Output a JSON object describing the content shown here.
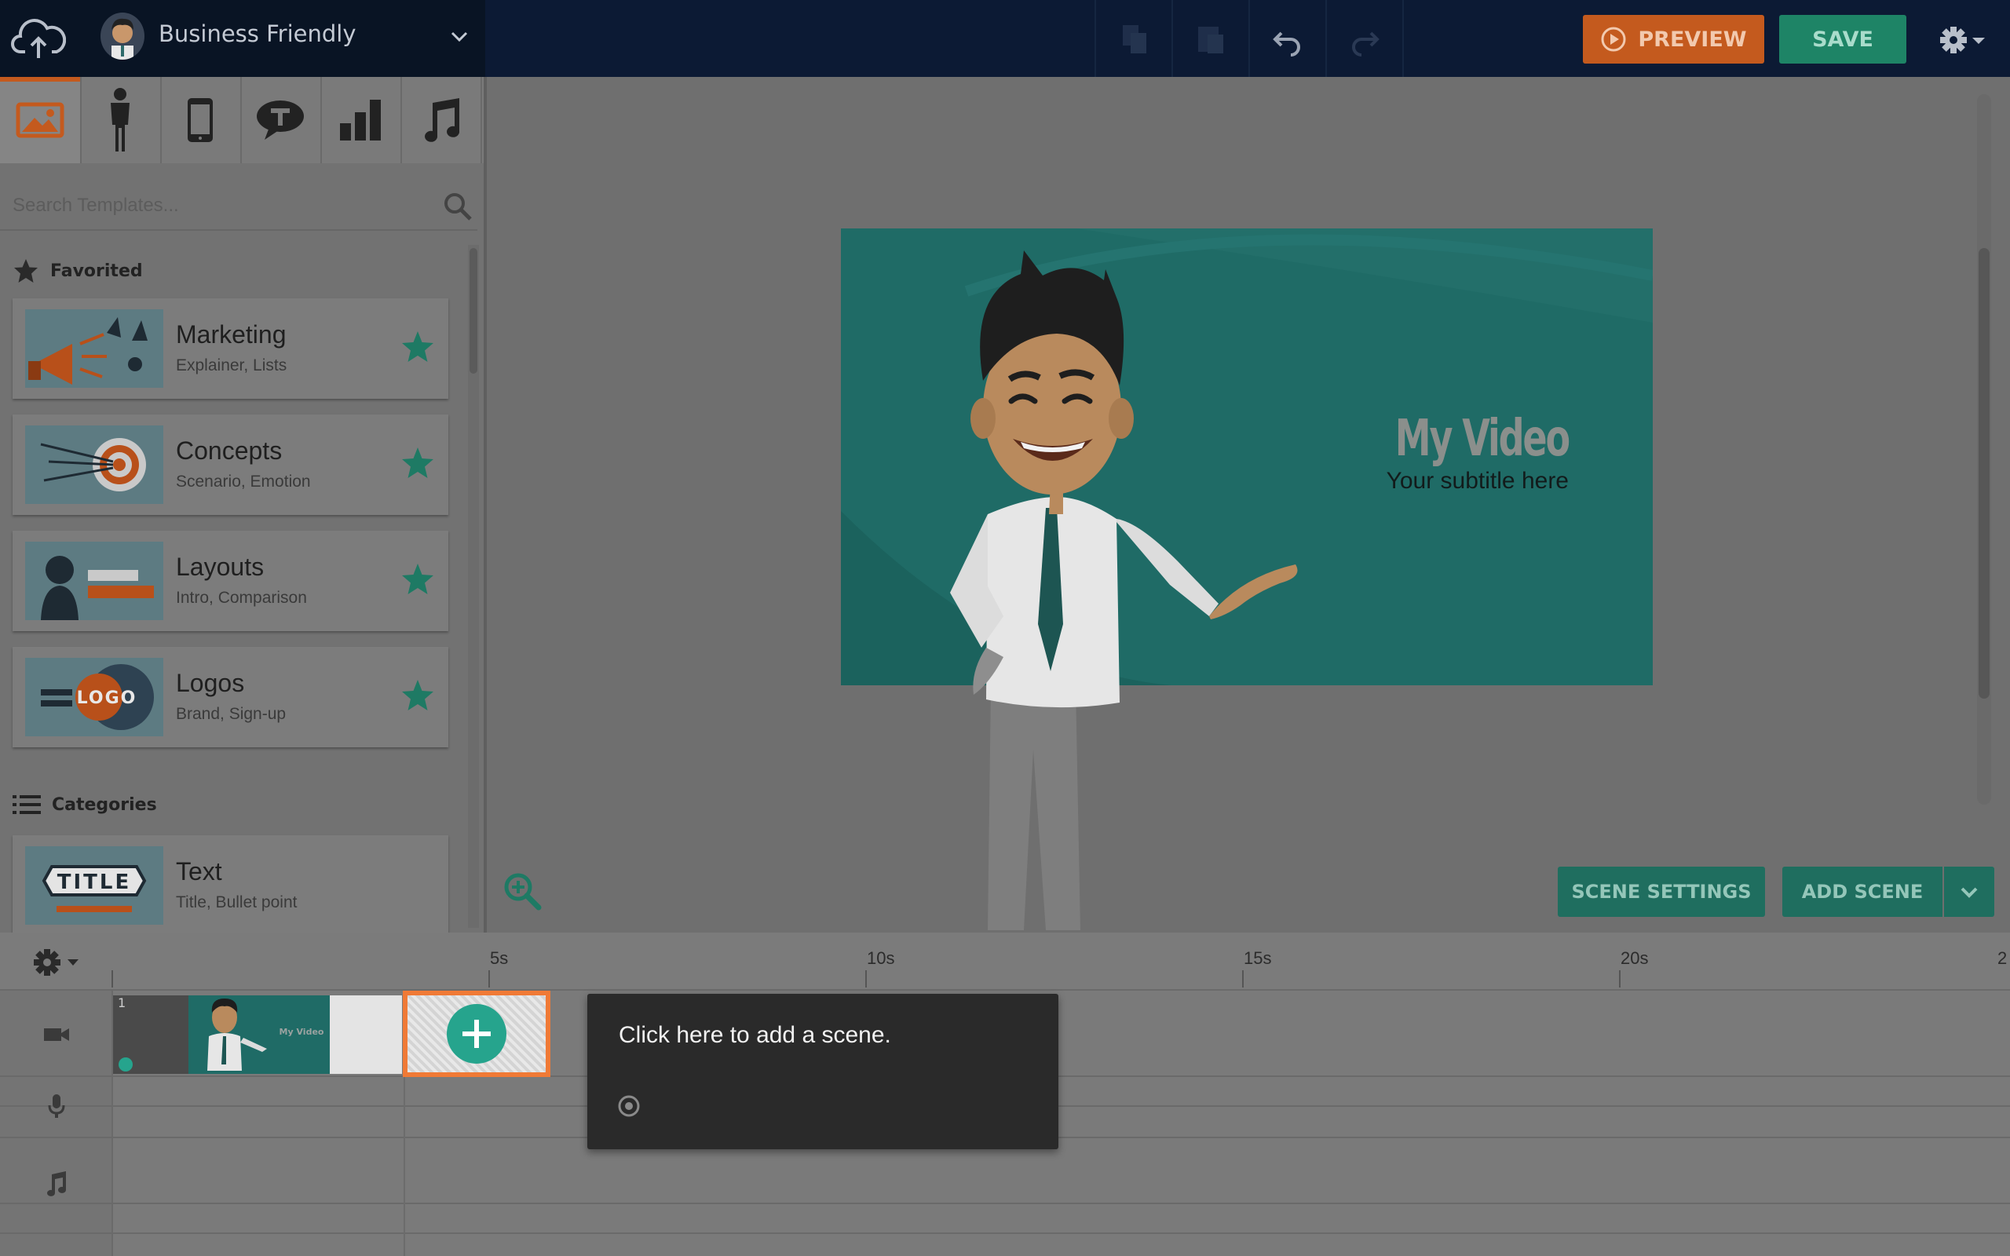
{
  "header": {
    "theme_name": "Business Friendly",
    "preview_label": "PREVIEW",
    "save_label": "SAVE",
    "accent_preview": "#c45a1e",
    "accent_save": "#1e8466"
  },
  "toolbar_icons": [
    "copy-icon",
    "paste-icon",
    "undo-icon",
    "redo-icon",
    "settings-gear-icon"
  ],
  "panel": {
    "tabs": [
      "image-icon",
      "character-icon",
      "device-icon",
      "text-bubble-icon",
      "chart-icon",
      "music-note-icon"
    ],
    "search_placeholder": "Search Templates...",
    "favorited_label": "Favorited",
    "categories_label": "Categories",
    "favorites": [
      {
        "title": "Marketing",
        "subtitle": "Explainer, Lists"
      },
      {
        "title": "Concepts",
        "subtitle": "Scenario, Emotion"
      },
      {
        "title": "Layouts",
        "subtitle": "Intro, Comparison"
      },
      {
        "title": "Logos",
        "subtitle": "Brand, Sign-up"
      }
    ],
    "categories": [
      {
        "title": "Text",
        "subtitle": "Title, Bullet point"
      }
    ],
    "logo_thumb_text": "LOGO",
    "text_thumb_text": "TITLE"
  },
  "stage": {
    "video_title": "My Video",
    "video_subtitle": "Your subtitle here",
    "scene_settings_label": "SCENE SETTINGS",
    "add_scene_label": "ADD SCENE"
  },
  "timeline": {
    "ticks": [
      "5s",
      "10s",
      "15s",
      "20s",
      "2"
    ],
    "scene_number": "1",
    "scene_thumb_title": "My Video",
    "tooltip_text": "Click here to add a scene."
  }
}
